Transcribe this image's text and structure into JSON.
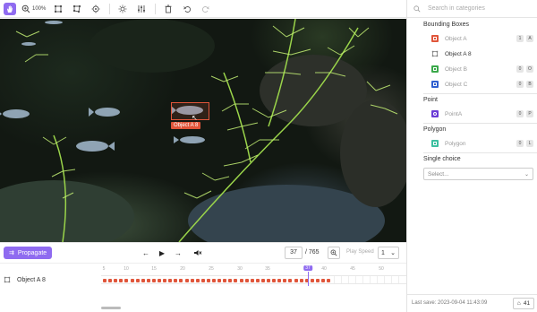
{
  "toolbar": {
    "zoom_label": "100%",
    "tools": [
      {
        "icon": "hand-icon",
        "active": true
      },
      {
        "icon": "zoom-icon"
      },
      {
        "icon": "bounding-box-icon"
      },
      {
        "icon": "polygon-icon"
      },
      {
        "icon": "point-icon"
      },
      {
        "icon": "brightness-icon"
      },
      {
        "icon": "adjust-sliders-icon"
      },
      {
        "icon": "delete-icon"
      },
      {
        "icon": "undo-icon"
      },
      {
        "icon": "redo-icon"
      }
    ]
  },
  "canvas": {
    "annotation_label": "Object A 8",
    "annotation_color": "#e0553a"
  },
  "playback": {
    "propagate_label": "Propagate",
    "current_frame": "37",
    "total_frames": "/ 765",
    "play_speed_label": "Play Speed",
    "play_speed_value": "1"
  },
  "timeline": {
    "track_label": "Object A 8",
    "ruler_labels": [
      "5",
      "10",
      "15",
      "20",
      "25",
      "30",
      "35",
      "37",
      "40",
      "45",
      "50"
    ],
    "current_marker": "37"
  },
  "panel": {
    "search_placeholder": "Search in categories",
    "sections": {
      "bounding_boxes": "Bounding Boxes",
      "point": "Point",
      "polygon": "Polygon",
      "single_choice": "Single choice"
    },
    "categories": {
      "object_a": {
        "label": "Object A",
        "key": "1",
        "count": "A",
        "color": "#e0553a"
      },
      "object_a8": {
        "label": "Object A 8",
        "color": "#888888"
      },
      "object_b": {
        "label": "Object B",
        "key": "0",
        "count": "O",
        "color": "#3aa84a"
      },
      "object_c": {
        "label": "Object C",
        "key": "0",
        "count": "B",
        "color": "#2f5fd0"
      },
      "pointa": {
        "label": "PointA",
        "key": "0",
        "count": "P",
        "color": "#6a3bd6"
      },
      "polygon": {
        "label": "Polygon",
        "key": "0",
        "count": "L",
        "color": "#3cc0a0"
      }
    },
    "select_placeholder": "Select...",
    "last_save": "Last save: 2023-09-04 11:43:09",
    "tag_count": "41"
  }
}
